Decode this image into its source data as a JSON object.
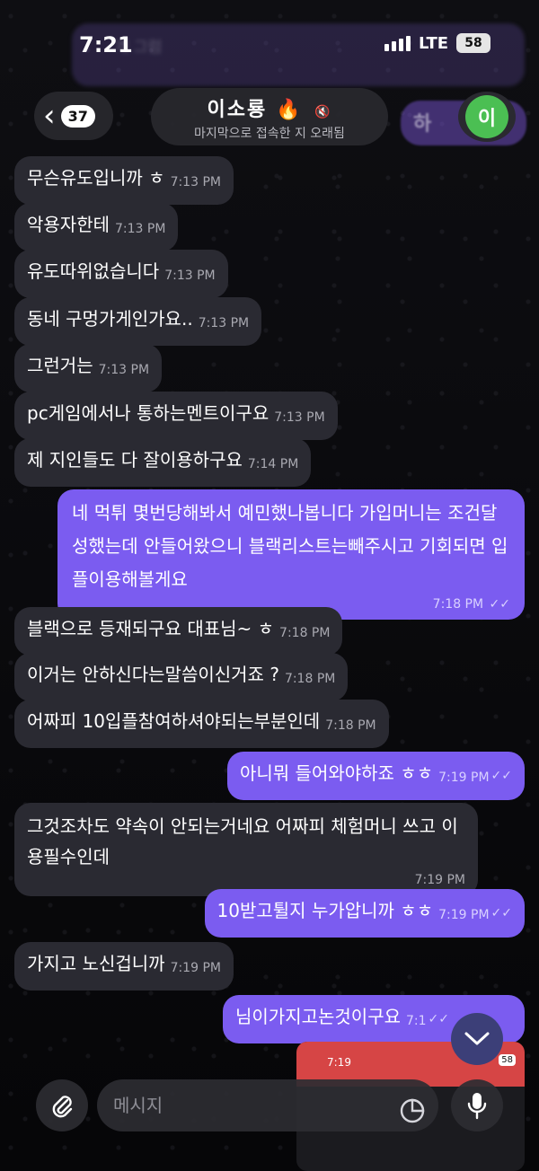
{
  "status_bar": {
    "time": "7:21",
    "network": "LTE",
    "battery": "58"
  },
  "notification_ghost": {
    "text": "재 그럼"
  },
  "ghost_bubble": {
    "text": "하"
  },
  "header": {
    "back_count": "37",
    "name": "이소룡",
    "name_emoji": "🔥",
    "last_seen": "마지막으로 접속한 지 오래됨",
    "avatar_letter": "이",
    "avatar_color": "#4bbf53"
  },
  "messages": [
    {
      "dir": "in",
      "text": "무슨유도입니까 ㅎ",
      "time": "7:13 PM"
    },
    {
      "dir": "in",
      "text": "악용자한테",
      "time": "7:13 PM"
    },
    {
      "dir": "in",
      "text": "유도따위없습니다",
      "time": "7:13 PM"
    },
    {
      "dir": "in",
      "text": "동네 구멍가게인가요..",
      "time": "7:13 PM"
    },
    {
      "dir": "in",
      "text": "그런거는",
      "time": "7:13 PM"
    },
    {
      "dir": "in",
      "text": "pc게임에서나 통하는멘트이구요",
      "time": "7:13 PM"
    },
    {
      "dir": "in",
      "text": "제 지인들도 다 잘이용하구요",
      "time": "7:14 PM"
    },
    {
      "dir": "out",
      "text": "네 먹튀 몇번당해봐서 예민했나봅니다 가입머니는 조건달성했는데 안들어왔으니 블랙리스트는빼주시고 기회되면 입플이용해볼게요",
      "time": "7:18 PM"
    },
    {
      "dir": "in",
      "text": "블랙으로 등재되구요 대표님~ ㅎ",
      "time": "7:18 PM"
    },
    {
      "dir": "in",
      "text": "이거는 안하신다는말씀이신거죠 ?",
      "time": "7:18 PM"
    },
    {
      "dir": "in",
      "text": "어짜피 10입플참여하셔야되는부분인데",
      "time": "7:18 PM"
    },
    {
      "dir": "out",
      "text": "아니뭐 들어와야하죠 ㅎㅎ",
      "time": "7:19 PM"
    },
    {
      "dir": "in",
      "text": "그것조차도 약속이 안되는거네요 어짜피 체험머니 쓰고 이용필수인데",
      "time": "7:19 PM"
    },
    {
      "dir": "out",
      "text": "10받고튈지 누가압니까 ㅎㅎ",
      "time": "7:19 PM"
    },
    {
      "dir": "in",
      "text": "가지고 노신겁니까",
      "time": "7:19 PM"
    },
    {
      "dir": "out",
      "text": "님이가지고논것이구요",
      "time": "7:1"
    }
  ],
  "read_ticks": "✓✓",
  "thumbnail": {
    "time": "7:19",
    "battery": "58"
  },
  "composer": {
    "placeholder": "메시지"
  },
  "colors": {
    "outgoing": "#7b5cf0",
    "incoming": "#2a2a32"
  }
}
